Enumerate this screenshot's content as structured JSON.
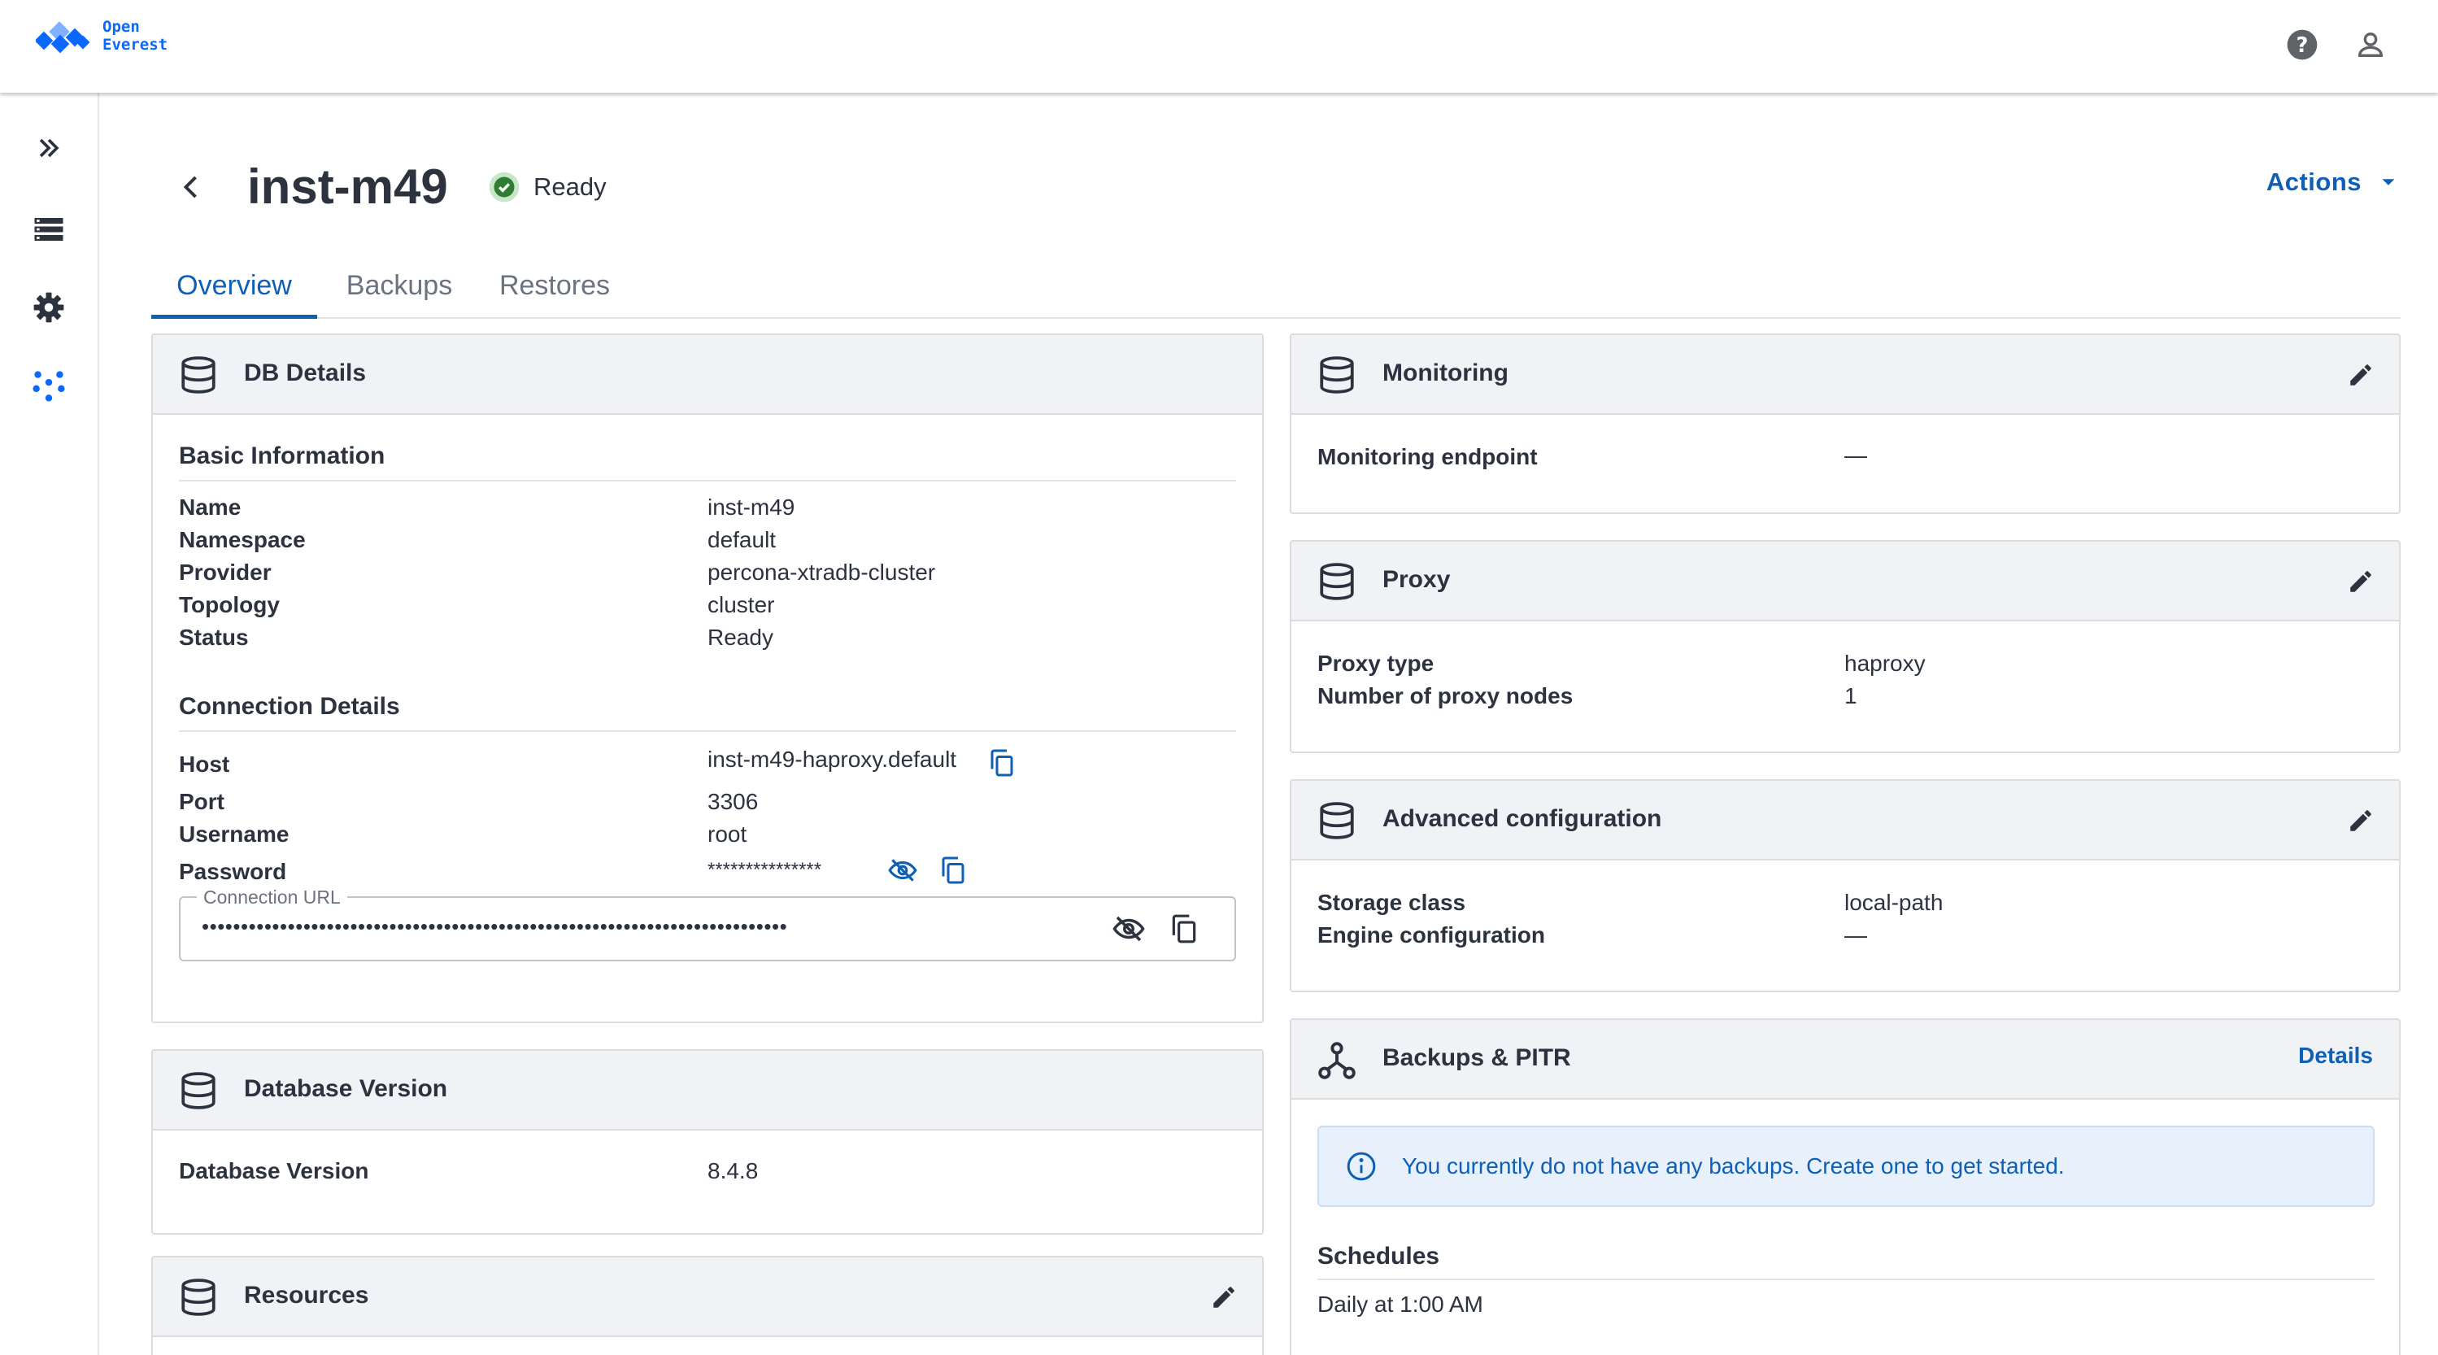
{
  "app": {
    "logo_line1": "Open",
    "logo_line2": "Everest"
  },
  "header": {
    "title": "inst-m49",
    "status": "Ready",
    "actions_label": "Actions"
  },
  "tabs": [
    {
      "label": "Overview"
    },
    {
      "label": "Backups"
    },
    {
      "label": "Restores"
    }
  ],
  "db_details": {
    "title": "DB Details",
    "basic_title": "Basic Information",
    "basic": [
      {
        "label": "Name",
        "value": "inst-m49"
      },
      {
        "label": "Namespace",
        "value": "default"
      },
      {
        "label": "Provider",
        "value": "percona-xtradb-cluster"
      },
      {
        "label": "Topology",
        "value": "cluster"
      },
      {
        "label": "Status",
        "value": "Ready"
      }
    ],
    "conn_title": "Connection Details",
    "connection": [
      {
        "label": "Host",
        "value": "inst-m49-haproxy.default"
      },
      {
        "label": "Port",
        "value": "3306"
      },
      {
        "label": "Username",
        "value": "root"
      },
      {
        "label": "Password",
        "value": "***************"
      }
    ],
    "url_label": "Connection URL",
    "url_value": "•••••••••••••••••••••••••••••••••••••••••••••••••••••••••••••••••••••••••••"
  },
  "database_version": {
    "title": "Database Version",
    "label": "Database Version",
    "value": "8.4.8"
  },
  "resources": {
    "title": "Resources"
  },
  "monitoring": {
    "title": "Monitoring",
    "label": "Monitoring endpoint",
    "value": "—"
  },
  "proxy": {
    "title": "Proxy",
    "rows": [
      {
        "label": "Proxy type",
        "value": "haproxy"
      },
      {
        "label": "Number of proxy nodes",
        "value": "1"
      }
    ]
  },
  "advanced": {
    "title": "Advanced configuration",
    "rows": [
      {
        "label": "Storage class",
        "value": "local-path"
      },
      {
        "label": "Engine configuration",
        "value": "—"
      }
    ]
  },
  "backups": {
    "title": "Backups & PITR",
    "details_link": "Details",
    "info": "You currently do not have any backups. Create one to get started.",
    "schedules_title": "Schedules",
    "schedule": "Daily at 1:00 AM"
  },
  "colors": {
    "primary": "#0e5fb5",
    "logo": "#0b68ff",
    "ready": "#2e7d32",
    "header_bg": "#f1f2f5"
  }
}
